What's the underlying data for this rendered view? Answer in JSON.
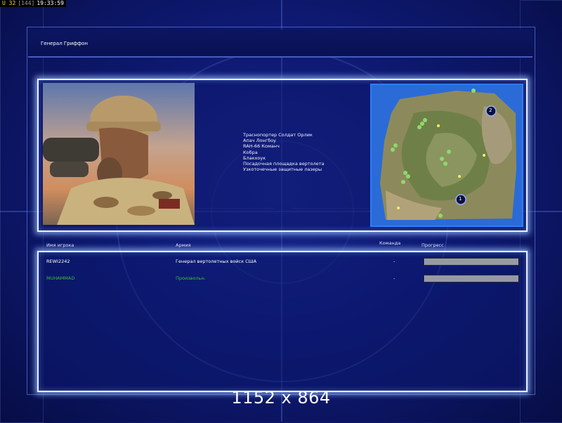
{
  "hud": {
    "unit": "U 32",
    "ping": "[144]",
    "clock": "19:33:59"
  },
  "title": "Генерал Гриффон",
  "briefing": {
    "units": [
      "Траснопортер Солдат Орлик",
      "Апач Лонгбоу",
      "RAH-66 Команч",
      "Кобра",
      "Блакхоук",
      "Посадочная площадка вертолета",
      "Узкоточечные защитные лазеры"
    ]
  },
  "minimap": {
    "markers": [
      "1",
      "2"
    ]
  },
  "players": {
    "headers": {
      "name": "Имя игрока",
      "army": "Армия",
      "team": "Команда",
      "progress": "Прогресс"
    },
    "rows": [
      {
        "name": "REWI2242",
        "army": "Генерал вертолетных войск США",
        "team": "-",
        "progress": 1.0,
        "color": "#ffffff"
      },
      {
        "name": "MUHAMMAD",
        "army": "Произвольн.",
        "team": "-",
        "progress": 1.0,
        "color": "#37c234"
      }
    ]
  },
  "resolution": "1152 x 864",
  "colors": {
    "panel_border": "#e8f0ff",
    "glow": "#96beff",
    "minimap_border": "#2e7dff"
  }
}
